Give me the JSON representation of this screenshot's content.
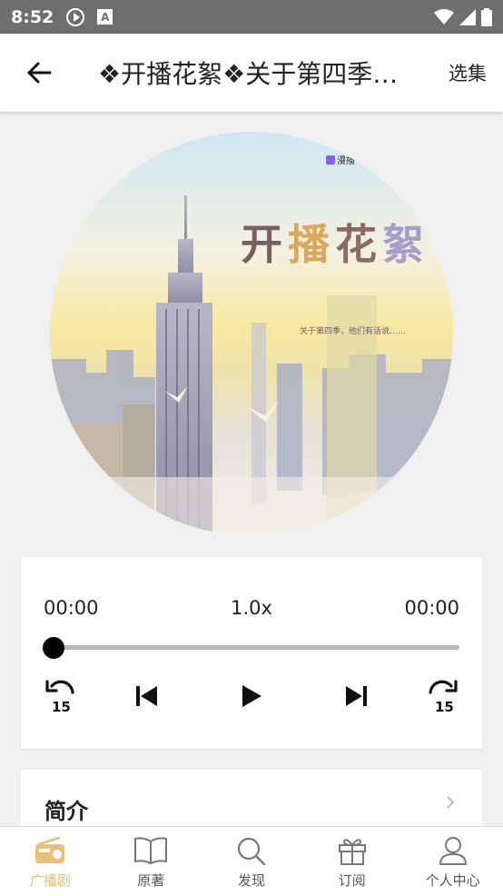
{
  "status_bar": {
    "time": "8:52",
    "notif_letter": "A"
  },
  "app_bar": {
    "title": "❖开播花絮❖关于第四季…",
    "select_label": "选集"
  },
  "cover": {
    "title_chars": [
      "开",
      "播",
      "花",
      "絮"
    ],
    "subtitle": "关于第四季，他们有话说……",
    "badge": "漫播"
  },
  "player": {
    "current_time": "00:00",
    "speed": "1.0x",
    "total_time": "00:00",
    "progress": 0,
    "rewind_seconds": "15",
    "forward_seconds": "15"
  },
  "intro": {
    "title": "简介"
  },
  "bottom_nav": {
    "items": [
      {
        "label": "广播剧",
        "icon": "radio-icon",
        "active": true
      },
      {
        "label": "原著",
        "icon": "book-icon",
        "active": false
      },
      {
        "label": "发现",
        "icon": "search-icon",
        "active": false
      },
      {
        "label": "订阅",
        "icon": "gift-icon",
        "active": false
      },
      {
        "label": "个人中心",
        "icon": "person-icon",
        "active": false
      }
    ]
  },
  "colors": {
    "accent": "#e9c07a",
    "status_bar": "#6e6e6e"
  }
}
